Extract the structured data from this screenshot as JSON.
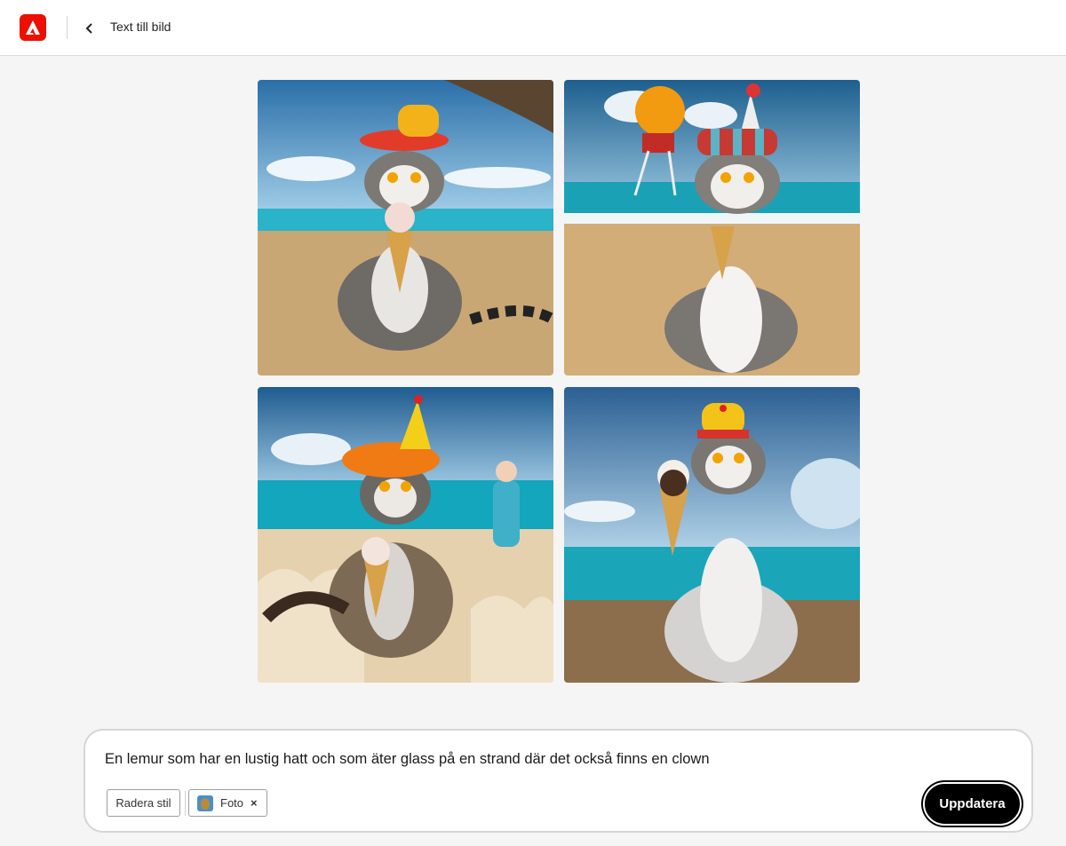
{
  "header": {
    "title": "Text till bild",
    "logo_icon": "adobe-logo-icon",
    "back_icon": "chevron-left-icon",
    "brand_color": "#eb1000"
  },
  "gallery": {
    "images": [
      {
        "subject": "lemur-icecream-beach-1"
      },
      {
        "subject": "lemur-icecream-beach-2"
      },
      {
        "subject": "lemur-icecream-beach-3"
      },
      {
        "subject": "lemur-icecream-beach-4"
      }
    ]
  },
  "prompt": {
    "text": "En lemur som har en lustig hatt och som äter glass på en strand där det också finns en clown",
    "clear_style_label": "Radera stil",
    "style_chip_label": "Foto",
    "style_chip_close": "×",
    "update_label": "Uppdatera"
  }
}
